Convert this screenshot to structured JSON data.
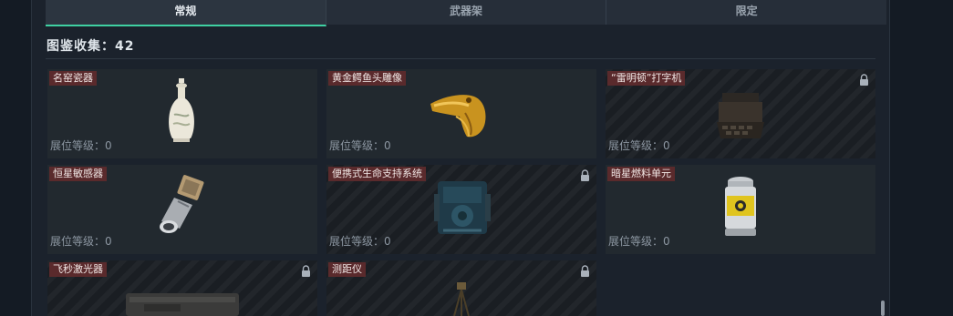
{
  "tabs": [
    {
      "label": "常规",
      "active": true
    },
    {
      "label": "武器架",
      "active": false
    },
    {
      "label": "限定",
      "active": false
    }
  ],
  "collection": {
    "title": "图鉴收集：42"
  },
  "items": [
    {
      "name": "名窑瓷器",
      "level": "展位等级：0",
      "locked": false,
      "icon": "porcelain-vase-icon"
    },
    {
      "name": "黄金鳄鱼头雕像",
      "level": "展位等级：0",
      "locked": false,
      "icon": "golden-crocodile-head-icon"
    },
    {
      "name": "“雷明顿”打字机",
      "level": "展位等级：0",
      "locked": true,
      "icon": "typewriter-icon"
    },
    {
      "name": "恒星敏感器",
      "level": "展位等级：0",
      "locked": false,
      "icon": "star-sensor-icon"
    },
    {
      "name": "便携式生命支持系统",
      "level": "展位等级：0",
      "locked": true,
      "icon": "life-support-system-icon"
    },
    {
      "name": "暗星燃料单元",
      "level": "展位等级：0",
      "locked": false,
      "icon": "fuel-cell-icon"
    },
    {
      "name": "飞秒激光器",
      "level": "",
      "locked": true,
      "icon": "femtosecond-laser-icon"
    },
    {
      "name": "测距仪",
      "level": "",
      "locked": true,
      "icon": "rangefinder-icon"
    }
  ],
  "colors": {
    "accent": "#3fd0a2",
    "label_bg": "#5a2a2c",
    "background": "#141b24"
  }
}
